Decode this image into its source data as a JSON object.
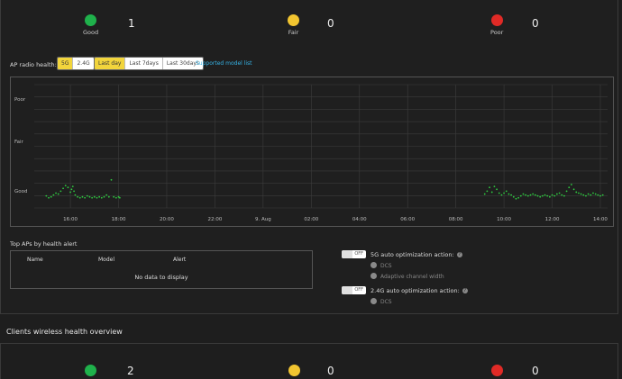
{
  "ap_status": [
    {
      "label": "Good",
      "count": "1",
      "color": "#1fb14b"
    },
    {
      "label": "Fair",
      "count": "0",
      "color": "#f2c530"
    },
    {
      "label": "Poor",
      "count": "0",
      "color": "#e02a26"
    }
  ],
  "radio_health": {
    "label": "AP radio health:",
    "bands": [
      "5G",
      "2.4G"
    ],
    "active_band": "5G",
    "ranges": [
      "Last day",
      "Last 7days",
      "Last 30days"
    ],
    "active_range": "Last day",
    "link": "Supported model list"
  },
  "chart_data": {
    "type": "scatter",
    "y_categories": [
      "Poor",
      "Fair",
      "Good"
    ],
    "x_ticks": [
      "16:00",
      "18:00",
      "20:00",
      "22:00",
      "9. Aug",
      "02:00",
      "04:00",
      "06:00",
      "08:00",
      "10:00",
      "12:00",
      "14:00"
    ],
    "point_color": "#2ecc40",
    "grid": true,
    "series": [
      {
        "values": [
          [
            15.0,
            0.35
          ],
          [
            15.1,
            0.25
          ],
          [
            15.2,
            0.3
          ],
          [
            15.3,
            0.4
          ],
          [
            15.4,
            0.5
          ],
          [
            15.5,
            0.45
          ],
          [
            15.6,
            0.6
          ],
          [
            15.7,
            0.75
          ],
          [
            15.8,
            0.9
          ],
          [
            15.9,
            0.8
          ],
          [
            16.0,
            0.55
          ],
          [
            16.05,
            0.7
          ],
          [
            16.1,
            0.85
          ],
          [
            16.15,
            0.6
          ],
          [
            16.2,
            0.4
          ],
          [
            16.3,
            0.3
          ],
          [
            16.4,
            0.25
          ],
          [
            16.5,
            0.3
          ],
          [
            16.6,
            0.25
          ],
          [
            16.7,
            0.35
          ],
          [
            16.8,
            0.3
          ],
          [
            16.9,
            0.25
          ],
          [
            17.0,
            0.3
          ],
          [
            17.1,
            0.25
          ],
          [
            17.2,
            0.3
          ],
          [
            17.3,
            0.25
          ],
          [
            17.4,
            0.3
          ],
          [
            17.5,
            0.4
          ],
          [
            17.6,
            0.3
          ],
          [
            17.7,
            1.2
          ],
          [
            17.8,
            0.3
          ],
          [
            17.9,
            0.25
          ],
          [
            18.0,
            0.3
          ],
          [
            18.05,
            0.25
          ],
          [
            33.2,
            0.45
          ],
          [
            33.3,
            0.6
          ],
          [
            33.4,
            0.8
          ],
          [
            33.5,
            0.55
          ],
          [
            33.6,
            0.85
          ],
          [
            33.7,
            0.7
          ],
          [
            33.8,
            0.5
          ],
          [
            33.9,
            0.4
          ],
          [
            34.0,
            0.5
          ],
          [
            34.1,
            0.6
          ],
          [
            34.2,
            0.45
          ],
          [
            34.3,
            0.4
          ],
          [
            34.4,
            0.3
          ],
          [
            34.5,
            0.2
          ],
          [
            34.6,
            0.25
          ],
          [
            34.7,
            0.35
          ],
          [
            34.8,
            0.45
          ],
          [
            34.9,
            0.4
          ],
          [
            35.0,
            0.35
          ],
          [
            35.1,
            0.4
          ],
          [
            35.2,
            0.45
          ],
          [
            35.3,
            0.4
          ],
          [
            35.4,
            0.35
          ],
          [
            35.5,
            0.3
          ],
          [
            35.6,
            0.35
          ],
          [
            35.7,
            0.4
          ],
          [
            35.8,
            0.35
          ],
          [
            35.9,
            0.3
          ],
          [
            36.0,
            0.4
          ],
          [
            36.1,
            0.35
          ],
          [
            36.2,
            0.45
          ],
          [
            36.3,
            0.5
          ],
          [
            36.4,
            0.4
          ],
          [
            36.5,
            0.35
          ],
          [
            36.6,
            0.6
          ],
          [
            36.7,
            0.8
          ],
          [
            36.8,
            0.95
          ],
          [
            36.9,
            0.7
          ],
          [
            37.0,
            0.55
          ],
          [
            37.1,
            0.5
          ],
          [
            37.2,
            0.45
          ],
          [
            37.3,
            0.4
          ],
          [
            37.4,
            0.35
          ],
          [
            37.5,
            0.45
          ],
          [
            37.6,
            0.4
          ],
          [
            37.7,
            0.5
          ],
          [
            37.8,
            0.45
          ],
          [
            37.9,
            0.4
          ],
          [
            38.0,
            0.35
          ],
          [
            38.1,
            0.4
          ]
        ]
      }
    ]
  },
  "top_aps": {
    "title": "Top APs by health alert",
    "columns": [
      "Name",
      "Model",
      "Alert"
    ],
    "empty": "No data to display"
  },
  "opt5g": {
    "toggle": "OFF",
    "title": "5G auto optimization action:",
    "info": "?",
    "options": [
      "DCS",
      "Adaptive channel width"
    ]
  },
  "opt24g": {
    "toggle": "OFF",
    "title": "2.4G auto optimization action:",
    "info": "?",
    "options": [
      "DCS"
    ]
  },
  "clients": {
    "title": "Clients wireless health overview",
    "status": [
      {
        "count": "2",
        "color": "#1fb14b"
      },
      {
        "count": "0",
        "color": "#f2c530"
      },
      {
        "count": "0",
        "color": "#e02a26"
      }
    ]
  }
}
